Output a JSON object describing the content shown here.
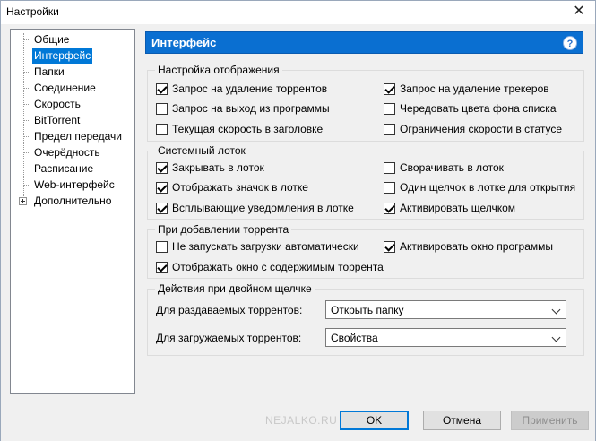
{
  "window": {
    "title": "Настройки",
    "close_glyph": "✕"
  },
  "tree": {
    "items": [
      {
        "label": "Общие"
      },
      {
        "label": "Интерфейс"
      },
      {
        "label": "Папки"
      },
      {
        "label": "Соединение"
      },
      {
        "label": "Скорость"
      },
      {
        "label": "BitTorrent"
      },
      {
        "label": "Предел передачи"
      },
      {
        "label": "Очерёдность"
      },
      {
        "label": "Расписание"
      },
      {
        "label": "Web-интерфейс"
      },
      {
        "label": "Дополнительно"
      }
    ],
    "selected": "Интерфейс"
  },
  "header": {
    "title": "Интерфейс",
    "help_glyph": "?"
  },
  "display": {
    "title": "Настройка отображения",
    "items": [
      {
        "label": "Запрос на удаление торрентов",
        "checked": true
      },
      {
        "label": "Запрос на удаление трекеров",
        "checked": true
      },
      {
        "label": "Запрос на выход из программы",
        "checked": false
      },
      {
        "label": "Чередовать цвета фона списка",
        "checked": false
      },
      {
        "label": "Текущая скорость в заголовке",
        "checked": false
      },
      {
        "label": "Ограничения скорости в статусе",
        "checked": false
      }
    ]
  },
  "tray": {
    "title": "Системный лоток",
    "items": [
      {
        "label": "Закрывать в лоток",
        "checked": true
      },
      {
        "label": "Сворачивать в лоток",
        "checked": false
      },
      {
        "label": "Отображать значок в лотке",
        "checked": true
      },
      {
        "label": "Один щелчок в лотке для открытия",
        "checked": false
      },
      {
        "label": "Всплывающие уведомления в лотке",
        "checked": true
      },
      {
        "label": "Активировать щелчком",
        "checked": true
      }
    ]
  },
  "add_torrent": {
    "title": "При добавлении торрента",
    "items": [
      {
        "label": "Не запускать загрузки автоматически",
        "checked": false
      },
      {
        "label": "Активировать окно программы",
        "checked": true
      },
      {
        "label": "Отображать окно с содержимым торрента",
        "checked": true
      }
    ]
  },
  "double_click": {
    "title": "Действия при двойном щелчке",
    "seeding_label": "Для раздаваемых торрентов:",
    "seeding_value": "Открыть папку",
    "downloading_label": "Для загружаемых торрентов:",
    "downloading_value": "Свойства"
  },
  "footer": {
    "watermark": "NEJALKO.RU",
    "ok": "OK",
    "cancel": "Отмена",
    "apply": "Применить"
  }
}
